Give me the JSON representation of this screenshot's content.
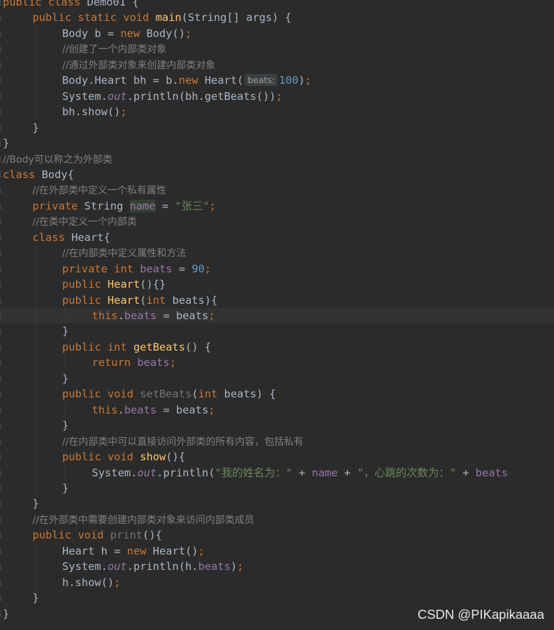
{
  "editor": {
    "lines": [
      {
        "indent": 0,
        "tokens": [
          {
            "t": "kw",
            "v": "public class "
          },
          {
            "t": "plain",
            "v": "Demo01 {"
          }
        ]
      },
      {
        "indent": 1,
        "tokens": [
          {
            "t": "kw",
            "v": "public static void "
          },
          {
            "t": "fn",
            "v": "main"
          },
          {
            "t": "plain",
            "v": "(String[] args) {"
          }
        ]
      },
      {
        "indent": 2,
        "tokens": [
          {
            "t": "plain",
            "v": "Body b = "
          },
          {
            "t": "kw",
            "v": "new "
          },
          {
            "t": "plain",
            "v": "Body()"
          },
          {
            "t": "kw",
            "v": ";"
          }
        ]
      },
      {
        "indent": 2,
        "tokens": [
          {
            "t": "cmt",
            "v": "//创建了一个内部类对象"
          }
        ]
      },
      {
        "indent": 2,
        "tokens": [
          {
            "t": "cmt",
            "v": "//通过外部类对象来创建内部类对象"
          }
        ]
      },
      {
        "indent": 2,
        "tokens": [
          {
            "t": "plain",
            "v": "Body.Heart bh = b."
          },
          {
            "t": "kw",
            "v": "new "
          },
          {
            "t": "plain",
            "v": "Heart("
          },
          {
            "t": "hint",
            "v": "beats:"
          },
          {
            "t": "num",
            "v": "100"
          },
          {
            "t": "plain",
            "v": ")"
          },
          {
            "t": "kw",
            "v": ";"
          }
        ]
      },
      {
        "indent": 2,
        "tokens": [
          {
            "t": "plain",
            "v": "System."
          },
          {
            "t": "static-field",
            "v": "out"
          },
          {
            "t": "plain",
            "v": ".println(bh.getBeats())"
          },
          {
            "t": "kw",
            "v": ";"
          }
        ]
      },
      {
        "indent": 2,
        "tokens": [
          {
            "t": "plain",
            "v": "bh.show()"
          },
          {
            "t": "kw",
            "v": ";"
          }
        ]
      },
      {
        "indent": 1,
        "tokens": [
          {
            "t": "plain",
            "v": "}"
          }
        ]
      },
      {
        "indent": 0,
        "tokens": [
          {
            "t": "plain",
            "v": "}"
          }
        ]
      },
      {
        "indent": 0,
        "tokens": [
          {
            "t": "cmt",
            "v": "//Body可以称之为外部类"
          }
        ]
      },
      {
        "indent": 0,
        "tokens": [
          {
            "t": "kw",
            "v": "class "
          },
          {
            "t": "plain",
            "v": "Body{"
          }
        ]
      },
      {
        "indent": 1,
        "tokens": [
          {
            "t": "cmt",
            "v": "//在外部类中定义一个私有属性"
          }
        ]
      },
      {
        "indent": 1,
        "tokens": [
          {
            "t": "kw",
            "v": "private "
          },
          {
            "t": "plain",
            "v": "String "
          },
          {
            "t": "highlight-name",
            "v": "name"
          },
          {
            "t": "plain",
            "v": " = "
          },
          {
            "t": "str",
            "v": "\"张三\""
          },
          {
            "t": "kw",
            "v": ";"
          }
        ]
      },
      {
        "indent": 1,
        "tokens": [
          {
            "t": "cmt",
            "v": "//在类中定义一个内部类"
          }
        ]
      },
      {
        "indent": 1,
        "tokens": [
          {
            "t": "kw",
            "v": "class "
          },
          {
            "t": "plain",
            "v": "Heart{"
          }
        ]
      },
      {
        "indent": 2,
        "tokens": [
          {
            "t": "cmt",
            "v": "//在内部类中定义属性和方法"
          }
        ]
      },
      {
        "indent": 2,
        "tokens": [
          {
            "t": "kw",
            "v": "private int "
          },
          {
            "t": "field",
            "v": "beats"
          },
          {
            "t": "plain",
            "v": " = "
          },
          {
            "t": "num",
            "v": "90"
          },
          {
            "t": "kw",
            "v": ";"
          }
        ]
      },
      {
        "indent": 2,
        "tokens": [
          {
            "t": "kw",
            "v": "public "
          },
          {
            "t": "fn",
            "v": "Heart"
          },
          {
            "t": "plain",
            "v": "(){}"
          }
        ]
      },
      {
        "indent": 2,
        "tokens": [
          {
            "t": "kw",
            "v": "public "
          },
          {
            "t": "fn",
            "v": "Heart"
          },
          {
            "t": "plain",
            "v": "("
          },
          {
            "t": "kw",
            "v": "int "
          },
          {
            "t": "plain",
            "v": "beats){"
          }
        ]
      },
      {
        "indent": 3,
        "current": true,
        "tokens": [
          {
            "t": "kw",
            "v": "this"
          },
          {
            "t": "plain",
            "v": "."
          },
          {
            "t": "field",
            "v": "beats"
          },
          {
            "t": "plain",
            "v": " = beats"
          },
          {
            "t": "kw",
            "v": ";"
          }
        ]
      },
      {
        "indent": 2,
        "tokens": [
          {
            "t": "plain",
            "v": "}"
          }
        ]
      },
      {
        "indent": 2,
        "tokens": [
          {
            "t": "kw",
            "v": "public int "
          },
          {
            "t": "fn",
            "v": "getBeats"
          },
          {
            "t": "plain",
            "v": "() {"
          }
        ]
      },
      {
        "indent": 3,
        "tokens": [
          {
            "t": "kw",
            "v": "return "
          },
          {
            "t": "field",
            "v": "beats"
          },
          {
            "t": "kw",
            "v": ";"
          }
        ]
      },
      {
        "indent": 2,
        "tokens": [
          {
            "t": "plain",
            "v": "}"
          }
        ]
      },
      {
        "indent": 2,
        "tokens": [
          {
            "t": "kw",
            "v": "public void "
          },
          {
            "t": "unused",
            "v": "setBeats"
          },
          {
            "t": "plain",
            "v": "("
          },
          {
            "t": "kw",
            "v": "int "
          },
          {
            "t": "plain",
            "v": "beats) {"
          }
        ]
      },
      {
        "indent": 3,
        "tokens": [
          {
            "t": "kw",
            "v": "this"
          },
          {
            "t": "plain",
            "v": "."
          },
          {
            "t": "field",
            "v": "beats"
          },
          {
            "t": "plain",
            "v": " = beats"
          },
          {
            "t": "kw",
            "v": ";"
          }
        ]
      },
      {
        "indent": 2,
        "tokens": [
          {
            "t": "plain",
            "v": "}"
          }
        ]
      },
      {
        "indent": 2,
        "tokens": [
          {
            "t": "cmt",
            "v": "//在内部类中可以直接访问外部类的所有内容，包括私有"
          }
        ]
      },
      {
        "indent": 2,
        "tokens": [
          {
            "t": "kw",
            "v": "public void "
          },
          {
            "t": "fn",
            "v": "show"
          },
          {
            "t": "plain",
            "v": "(){"
          }
        ]
      },
      {
        "indent": 3,
        "tokens": [
          {
            "t": "plain",
            "v": "System."
          },
          {
            "t": "static-field",
            "v": "out"
          },
          {
            "t": "plain",
            "v": ".println("
          },
          {
            "t": "str",
            "v": "\"我的姓名为：\""
          },
          {
            "t": "plain",
            "v": " + "
          },
          {
            "t": "field",
            "v": "name"
          },
          {
            "t": "plain",
            "v": " + "
          },
          {
            "t": "str",
            "v": "\"，心跳的次数为：\""
          },
          {
            "t": "plain",
            "v": " + "
          },
          {
            "t": "field",
            "v": "beats"
          }
        ]
      },
      {
        "indent": 2,
        "tokens": [
          {
            "t": "plain",
            "v": "}"
          }
        ]
      },
      {
        "indent": 1,
        "tokens": [
          {
            "t": "plain",
            "v": "}"
          }
        ]
      },
      {
        "indent": 1,
        "tokens": [
          {
            "t": "cmt",
            "v": "//在外部类中需要创建内部类对象来访问内部类成员"
          }
        ]
      },
      {
        "indent": 1,
        "tokens": [
          {
            "t": "kw",
            "v": "public void "
          },
          {
            "t": "unused",
            "v": "print"
          },
          {
            "t": "plain",
            "v": "(){"
          }
        ]
      },
      {
        "indent": 2,
        "tokens": [
          {
            "t": "plain",
            "v": "Heart h = "
          },
          {
            "t": "kw",
            "v": "new "
          },
          {
            "t": "plain",
            "v": "Heart()"
          },
          {
            "t": "kw",
            "v": ";"
          }
        ]
      },
      {
        "indent": 2,
        "tokens": [
          {
            "t": "plain",
            "v": "System."
          },
          {
            "t": "static-field",
            "v": "out"
          },
          {
            "t": "plain",
            "v": ".println(h."
          },
          {
            "t": "field",
            "v": "beats"
          },
          {
            "t": "plain",
            "v": ")"
          },
          {
            "t": "kw",
            "v": ";"
          }
        ]
      },
      {
        "indent": 2,
        "tokens": [
          {
            "t": "plain",
            "v": "h.show()"
          },
          {
            "t": "kw",
            "v": ";"
          }
        ]
      },
      {
        "indent": 1,
        "tokens": [
          {
            "t": "plain",
            "v": "}"
          }
        ]
      },
      {
        "indent": 0,
        "tokens": [
          {
            "t": "plain",
            "v": "}"
          }
        ]
      }
    ]
  },
  "watermark": "CSDN @PIKapikaaaa",
  "colors": {
    "background": "#2b2b2b",
    "keyword": "#cc7832",
    "function": "#ffc66d",
    "field": "#9876aa",
    "number": "#6897bb",
    "string": "#6a8759",
    "comment": "#808080",
    "text": "#a9b7c6"
  }
}
